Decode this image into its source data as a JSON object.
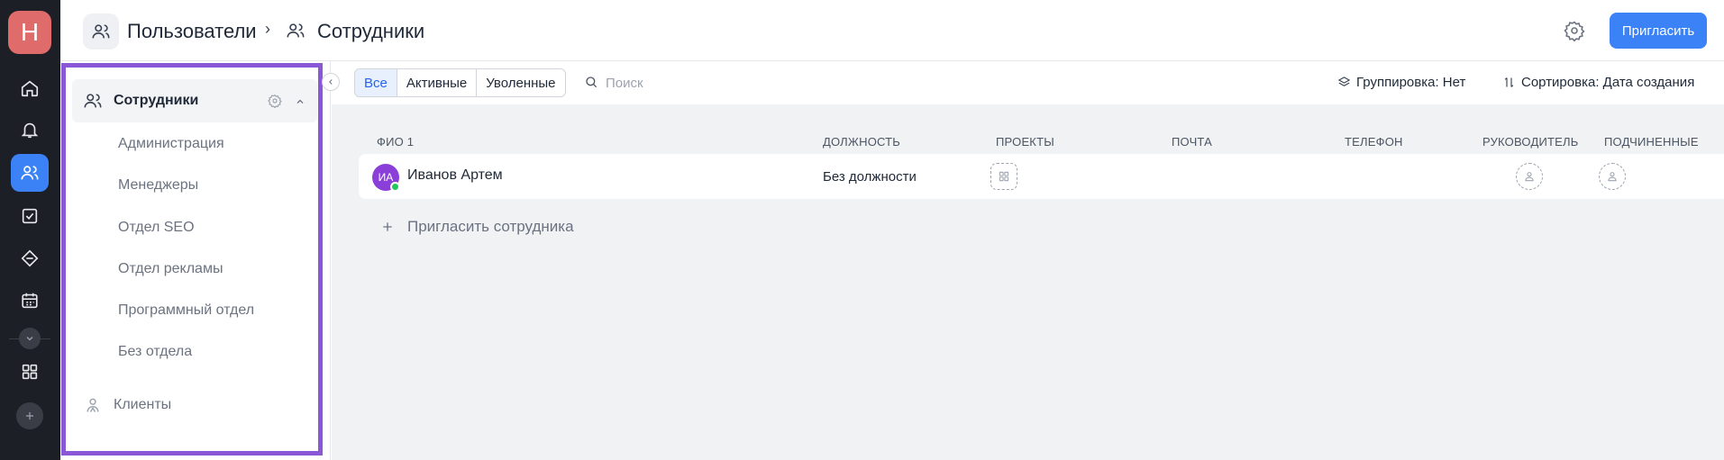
{
  "app": {
    "logo_letter": "H",
    "accent": "#3b82f6",
    "logo_color": "#e06b6b",
    "highlight_color": "#8a57d6"
  },
  "rail": {
    "items": [
      "home-icon",
      "bell-icon",
      "users-icon",
      "checklist-icon",
      "deals-icon",
      "calendar-icon",
      "chevron-down-icon",
      "apps-grid-icon",
      "add-icon"
    ]
  },
  "header": {
    "crumb_parent": "Пользователи",
    "crumb_separator": "›",
    "crumb_current": "Сотрудники",
    "invite_label": "Пригласить"
  },
  "sidebar": {
    "group_label": "Сотрудники",
    "items": [
      {
        "label": "Администрация"
      },
      {
        "label": "Менеджеры"
      },
      {
        "label": "Отдел SEO"
      },
      {
        "label": "Отдел рекламы"
      },
      {
        "label": "Программный отдел"
      },
      {
        "label": "Без отдела"
      }
    ],
    "clients_label": "Клиенты"
  },
  "toolbar": {
    "filters": [
      {
        "label": "Все",
        "active": true
      },
      {
        "label": "Активные",
        "active": false
      },
      {
        "label": "Уволенные",
        "active": false
      }
    ],
    "search_placeholder": "Поиск",
    "grouping": "Группировка: Нет",
    "sorting": "Сортировка: Дата создания"
  },
  "table": {
    "columns": [
      "ФИО 1",
      "Должность",
      "Проекты",
      "Почта",
      "Телефон",
      "Руководитель",
      "Подчиненные"
    ],
    "rows": [
      {
        "initials": "ИА",
        "name": "Иванов Артем",
        "position": "Без должности",
        "email": "",
        "phone": ""
      }
    ],
    "invite_employee": "Пригласить сотрудника"
  }
}
